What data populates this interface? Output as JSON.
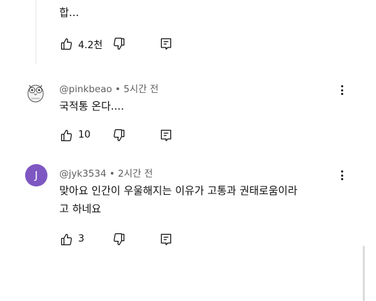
{
  "comments": [
    {
      "text_line1": "합...",
      "likes": "4.2천"
    },
    {
      "author": "@pinkbeao",
      "dot": "•",
      "time": "5시간 전",
      "text": "국적통 온다....",
      "likes": "10"
    },
    {
      "author": "@jyk3534",
      "dot": "•",
      "time": "2시간 전",
      "avatar_letter": "J",
      "avatar_color": "#7e57c2",
      "text_line1": "맞아요 인간이 우울해지는 이유가 고통과 권태로움이라",
      "text_line2": "고 하네요",
      "likes": "3"
    }
  ],
  "icons": {
    "like": "thumbs-up-icon",
    "dislike": "thumbs-down-icon",
    "reply": "reply-icon",
    "more": "more-vert-icon"
  }
}
